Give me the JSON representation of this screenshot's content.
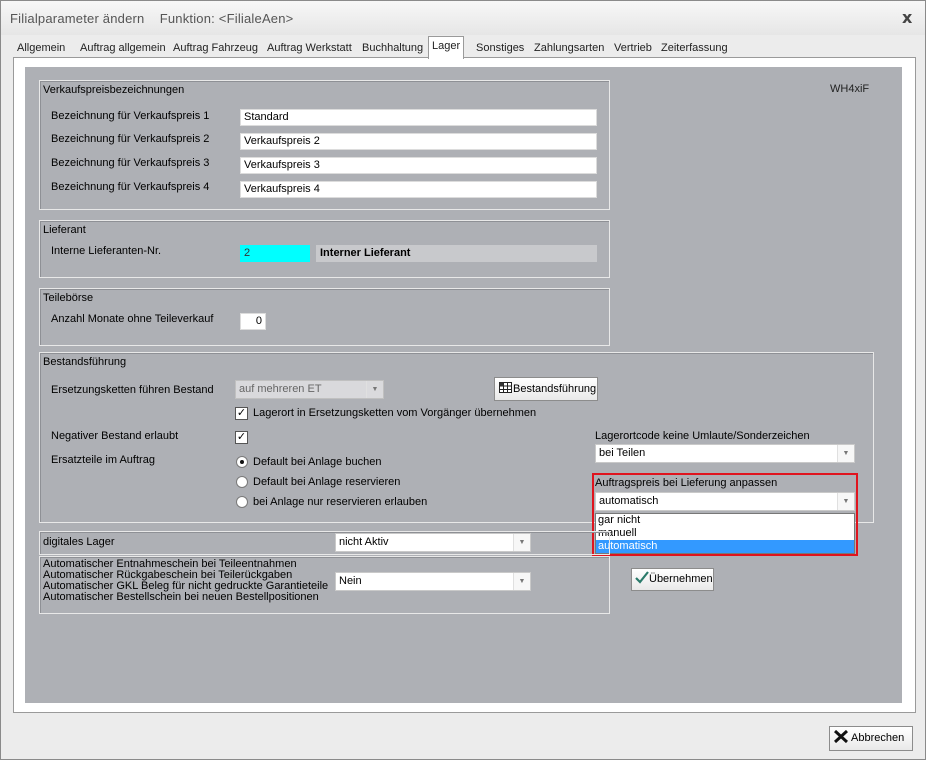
{
  "window": {
    "title": "Filialparameter ändern    Funktion: <FilialeAen>",
    "close": "x"
  },
  "tabs": [
    {
      "label": "Allgemein",
      "active": false
    },
    {
      "label": "Auftrag allgemein",
      "active": false
    },
    {
      "label": "Auftrag Fahrzeug",
      "active": false
    },
    {
      "label": "Auftrag Werkstatt",
      "active": false
    },
    {
      "label": "Buchhaltung",
      "active": false
    },
    {
      "label": "Lager",
      "active": true
    },
    {
      "label": "Sonstiges",
      "active": false
    },
    {
      "label": "Zahlungsarten",
      "active": false
    },
    {
      "label": "Vertrieb",
      "active": false
    },
    {
      "label": "Zeiterfassung",
      "active": false
    }
  ],
  "code_label": "WH4xiF",
  "verkaufspreis": {
    "title": "Verkaufspreisbezeichnungen",
    "rows": [
      {
        "label": "Bezeichnung für Verkaufspreis 1",
        "value": "Standard"
      },
      {
        "label": "Bezeichnung für Verkaufspreis 2",
        "value": "Verkaufspreis 2"
      },
      {
        "label": "Bezeichnung für Verkaufspreis 3",
        "value": "Verkaufspreis 3"
      },
      {
        "label": "Bezeichnung für Verkaufspreis 4",
        "value": "Verkaufspreis 4"
      }
    ]
  },
  "lieferant": {
    "title": "Lieferant",
    "label": "Interne Lieferanten-Nr.",
    "number": "2",
    "name": "Interner Lieferant",
    "number_color": "#00ffff"
  },
  "teileboerse": {
    "title": "Teilebörse",
    "label": "Anzahl Monate ohne Teileverkauf",
    "value": "0"
  },
  "bestand": {
    "title": "Bestandsführung",
    "ersetzung_label": "Ersetzungsketten führen Bestand",
    "ersetzung_value": "auf mehreren ET",
    "button_label": "Bestandsführung",
    "lagerort_check_label": "Lagerort in Ersetzungsketten vom Vorgänger übernehmen",
    "lagerort_checked": true,
    "negativ_label": "Negativer Bestand erlaubt",
    "negativ_checked": true,
    "ersatzteile_label": "Ersatzteile im Auftrag",
    "radios": [
      {
        "label": "Default bei Anlage buchen",
        "selected": true
      },
      {
        "label": "Default bei Anlage reservieren",
        "selected": false
      },
      {
        "label": "bei Anlage nur reservieren erlauben",
        "selected": false
      }
    ],
    "lagerortcode_label": "Lagerortcode keine Umlaute/Sonderzeichen",
    "lagerortcode_value": "bei Teilen",
    "auftragspreis_label": "Auftragspreis bei Lieferung anpassen",
    "auftragspreis_value": "automatisch",
    "auftragspreis_options": [
      {
        "label": "gar nicht",
        "selected": false
      },
      {
        "label": "manuell",
        "selected": false
      },
      {
        "label": "automatisch",
        "selected": true
      }
    ]
  },
  "digital": {
    "label": "digitales Lager",
    "value": "nicht Aktiv"
  },
  "automatik": {
    "lines": [
      "Automatischer Entnahmeschein bei Teileentnahmen",
      "Automatischer Rückgabeschein bei Teilerückgaben",
      "Automatischer GKL Beleg für nicht gedruckte Garantieteile",
      "Automatischer Bestellschein bei neuen Bestellpositionen"
    ],
    "value": "Nein"
  },
  "buttons": {
    "uebernehmen": "Übernehmen",
    "abbrechen": "Abbrechen"
  },
  "colors": {
    "panel_bg": "#aeb0b5",
    "highlight": "#e0141e",
    "selection": "#3399ff"
  }
}
